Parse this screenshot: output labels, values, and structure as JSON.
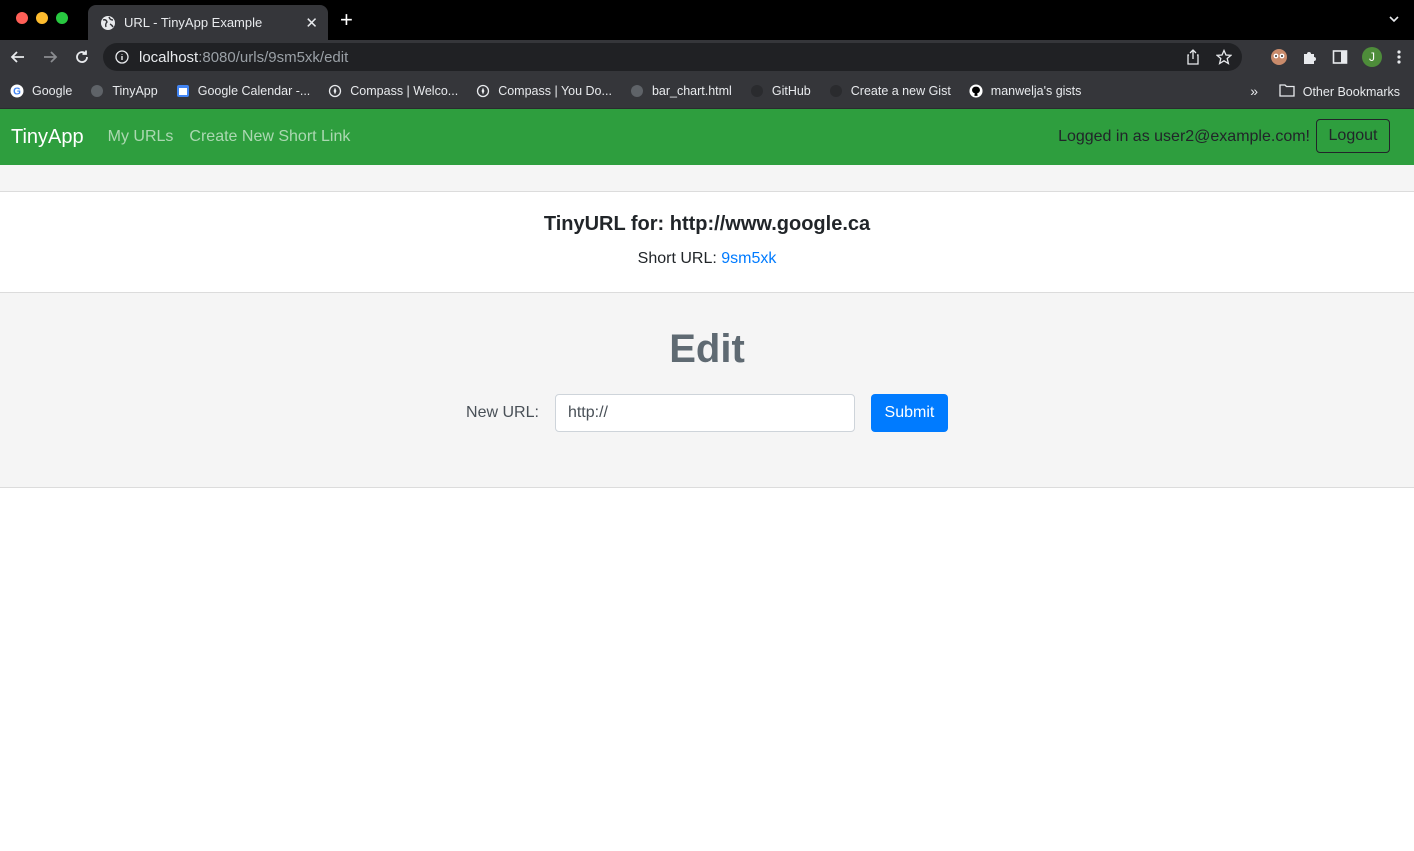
{
  "browser": {
    "tab_title": "URL - TinyApp Example",
    "url_host": "localhost",
    "url_path": ":8080/urls/9sm5xk/edit",
    "profile_initial": "J",
    "bookmarks": [
      {
        "label": "Google",
        "icon": "google-icon"
      },
      {
        "label": "TinyApp",
        "icon": "globe-icon"
      },
      {
        "label": "Google Calendar -...",
        "icon": "calendar-icon"
      },
      {
        "label": "Compass | Welco...",
        "icon": "compass-icon"
      },
      {
        "label": "Compass | You Do...",
        "icon": "compass-icon"
      },
      {
        "label": "bar_chart.html",
        "icon": "globe-icon"
      },
      {
        "label": "GitHub",
        "icon": "github-icon"
      },
      {
        "label": "Create a new Gist",
        "icon": "github-icon"
      },
      {
        "label": "manwelja's gists",
        "icon": "github-icon"
      }
    ],
    "other_bookmarks": "Other Bookmarks"
  },
  "navbar": {
    "brand": "TinyApp",
    "links": [
      "My URLs",
      "Create New Short Link"
    ],
    "login_text": "Logged in as user2@example.com!",
    "logout_label": "Logout",
    "color": "#2e9e3e"
  },
  "card": {
    "title": "TinyURL for: http://www.google.ca",
    "short_label": "Short URL:",
    "short_value": "9sm5xk"
  },
  "edit": {
    "heading": "Edit",
    "label": "New URL:",
    "input_value": "http://",
    "submit_label": "Submit"
  }
}
